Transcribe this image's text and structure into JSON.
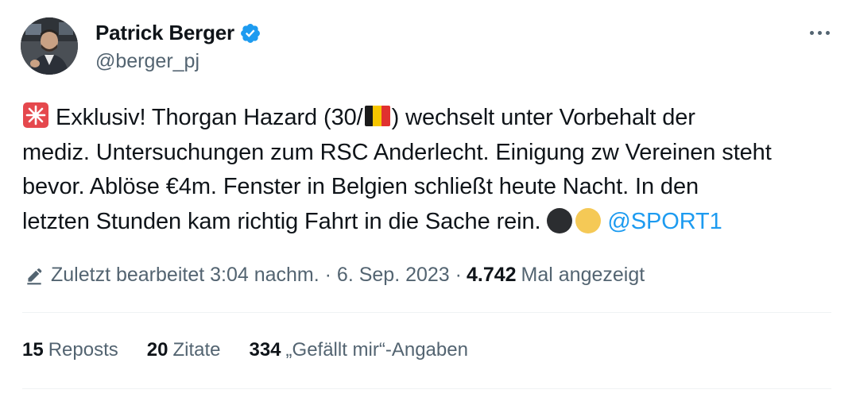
{
  "author": {
    "name": "Patrick Berger",
    "handle": "@berger_pj",
    "verified": true
  },
  "tweet": {
    "lines": [
      {
        "before": " Exklusiv! Thorgan Hazard (30/",
        "after": ") wechselt unter Vorbehalt der"
      },
      {
        "text": "mediz. Untersuchungen zum RSC Anderlecht. Einigung zw Vereinen steht"
      },
      {
        "text": "bevor.  Ablöse €4m. Fenster in Belgien schließt heute Nacht. In den"
      },
      {
        "text": "letzten Stunden kam richtig Fahrt in die Sache rein. "
      }
    ],
    "mention": "@SPORT1",
    "emoji": {
      "siren": "rotating-light-icon",
      "flag": "belgium-flag-icon",
      "circles": [
        "#2b2d30",
        "#f5c956"
      ]
    }
  },
  "meta": {
    "edited": "Zuletzt bearbeitet 3:04 nachm. · 6. Sep. 2023 ·",
    "views_count": "4.742",
    "views_label": "Mal angezeigt"
  },
  "stats": {
    "reposts": {
      "count": "15",
      "label": "Reposts"
    },
    "quotes": {
      "count": "20",
      "label": "Zitate"
    },
    "likes": {
      "count": "334",
      "label": "„Gefällt mir“-Angaben"
    }
  },
  "colors": {
    "accent": "#1d9bf0",
    "secondary_text": "#536471",
    "primary_text": "#0f1419",
    "divider": "#eff3f4"
  }
}
